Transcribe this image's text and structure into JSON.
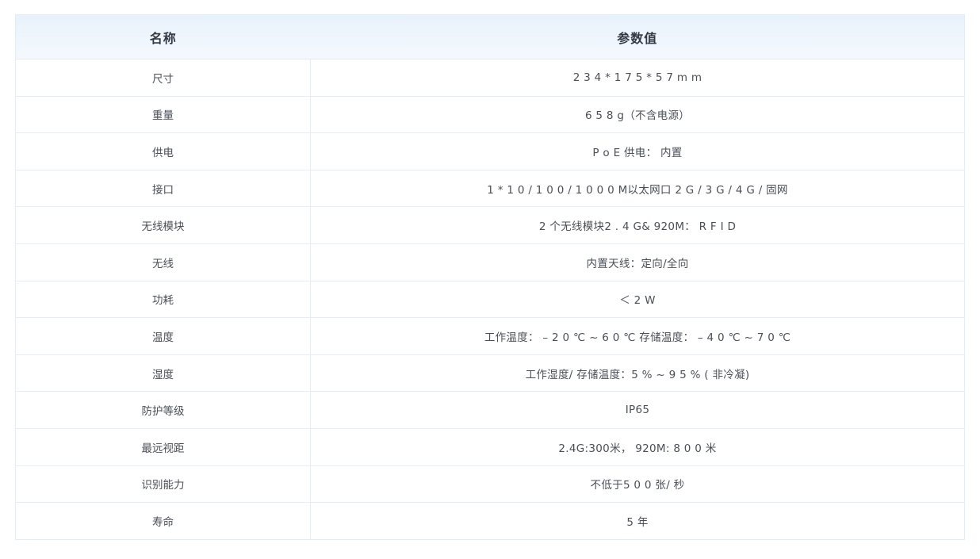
{
  "table": {
    "headers": [
      "名称",
      "参数值"
    ],
    "rows": [
      {
        "name": "尺寸",
        "value": "2 3 4 * 1 7 5 * 5 7 m m"
      },
      {
        "name": "重量",
        "value": "6 5 8 g（不含电源）"
      },
      {
        "name": "供电",
        "value": "P o E 供电： 内置"
      },
      {
        "name": "接口",
        "value": "1 * 1 0 / 1 0 0 / 1 0 0 0 M以太网口   2 G / 3 G / 4 G / 固网"
      },
      {
        "name": "无线模块",
        "value": "2 个无线模块2 . 4 G& 920M：  R F I D"
      },
      {
        "name": "无线",
        "value": "内置天线：定向/全向"
      },
      {
        "name": "功耗",
        "value": "＜ 2 W"
      },
      {
        "name": "温度",
        "value": "工作温度：  – 2 0 ℃ ~ 6 0 ℃  存储温度：  – 4 0 ℃ ~ 7 0 ℃"
      },
      {
        "name": "湿度",
        "value": "工作湿度/ 存储温度：5 % ~ 9 5 % ( 非冷凝)"
      },
      {
        "name": "防护等级",
        "value": "IP65"
      },
      {
        "name": "最远视距",
        "value": "2.4G:300米，  920M: 8 0 0 米"
      },
      {
        "name": "识别能力",
        "value": "不低于5 0 0 张/ 秒"
      },
      {
        "name": "寿命",
        "value": "5 年"
      }
    ]
  }
}
